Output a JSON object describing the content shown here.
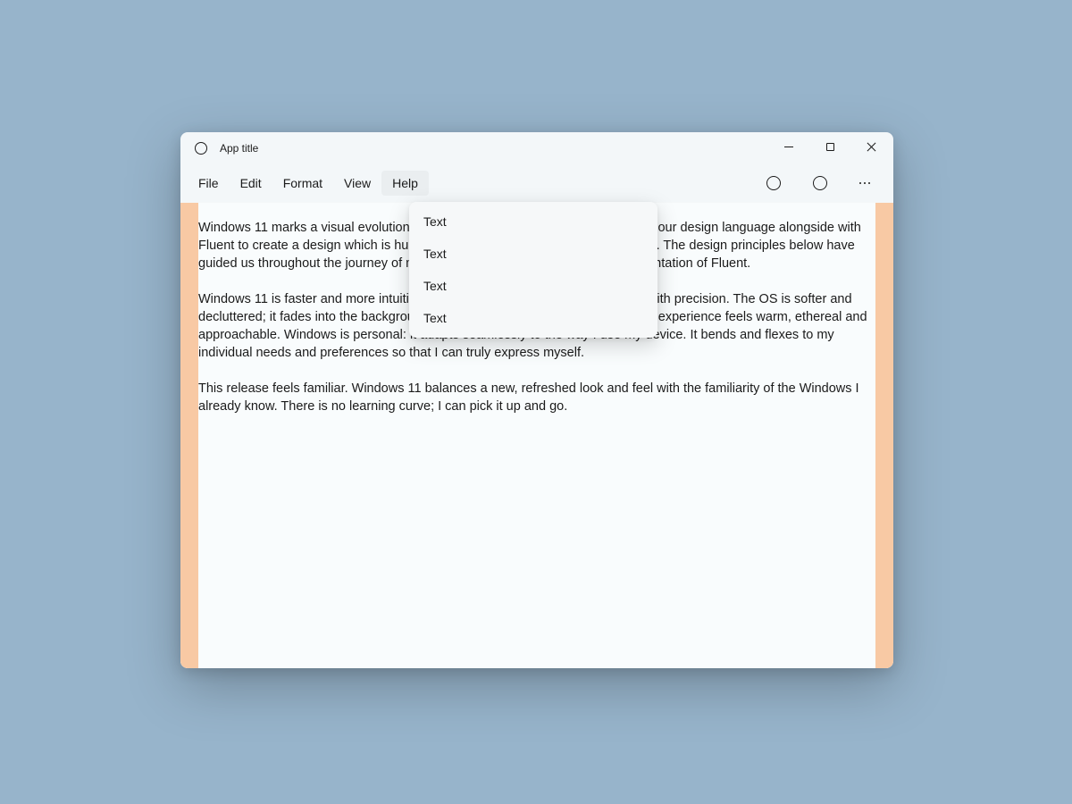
{
  "titlebar": {
    "title": "App title"
  },
  "menubar": {
    "items": [
      {
        "label": "File",
        "active": false
      },
      {
        "label": "Edit",
        "active": false
      },
      {
        "label": "Format",
        "active": false
      },
      {
        "label": "View",
        "active": false
      },
      {
        "label": "Help",
        "active": true
      }
    ]
  },
  "dropdown": {
    "items": [
      {
        "label": "Text"
      },
      {
        "label": "Text"
      },
      {
        "label": "Text"
      },
      {
        "label": "Text"
      }
    ]
  },
  "document": {
    "paragraphs": [
      "Windows 11 marks a visual evolution of the operating system. We have evolved our design language alongside with Fluent to create a design which is human, universal and truly feels like Windows. The design principles below have guided us throughout the journey of making Windows the best-in-class implementation of Fluent.",
      "Windows 11 is faster and more intuitive. The experience is calm and effortless with precision. The OS is softer and decluttered; it fades into the background to help me stay calm and focused. The experience feels warm, ethereal and approachable.  Windows is personal: it adapts seamlessly to the way I use my device. It bends and flexes to my individual needs and preferences so that I can truly express myself.",
      "This release feels familiar. Windows 11 balances a new, refreshed look and feel with the familiarity of the Windows I already know. There is no learning curve; I can pick it up and go."
    ]
  },
  "colors": {
    "highlight": "#f8c9a4",
    "background": "#97b4cb",
    "window": "#f3f7f9"
  }
}
